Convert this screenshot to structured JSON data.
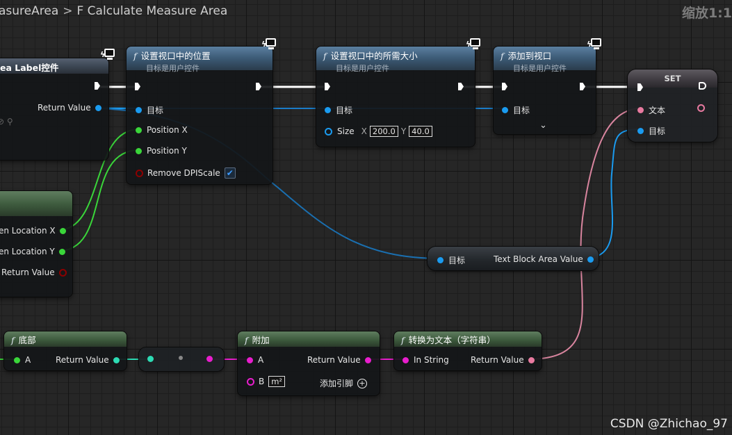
{
  "breadcrumb": {
    "parent": "asureArea",
    "current": "F Calculate Measure Area"
  },
  "zoom": "缩放1:1",
  "watermark": "CSDN @Zhichao_97",
  "nodes": {
    "create_widget": {
      "title": "ea Label控件",
      "return_label": "Return Value"
    },
    "set_position": {
      "title": "设置视口中的位置",
      "subtitle": "目标是用户控件",
      "target": "目标",
      "pos_x": "Position X",
      "pos_y": "Position Y",
      "remove_dpi": "Remove DPIScale"
    },
    "set_desired_size": {
      "title": "设置视口中的所需大小",
      "subtitle": "目标是用户控件",
      "target": "目标",
      "size": "Size",
      "x_label": "X",
      "x_value": "200.0",
      "y_label": "Y",
      "y_value": "40.0"
    },
    "add_to_viewport": {
      "title": "添加到视口",
      "subtitle": "目标是用户控件",
      "target": "目标"
    },
    "set_node": {
      "title": "SET",
      "text": "文本",
      "target": "目标"
    },
    "screen_location": {
      "x": "en Location X",
      "y": "en Location Y",
      "return": "Return Value"
    },
    "text_block_var": {
      "target": "目标",
      "value": "Text Block Area Value"
    },
    "bottom": {
      "title": "底部",
      "a": "A",
      "return": "Return Value"
    },
    "append": {
      "title": "附加",
      "a": "A",
      "b": "B",
      "b_value": "m²",
      "return": "Return Value",
      "add_pin": "添加引脚"
    },
    "to_text": {
      "title": "转换为文本（字符串）",
      "in": "In String",
      "return": "Return Value"
    }
  },
  "colors": {
    "exec": "#ffffff",
    "object": "#1a9bf0",
    "float": "#3ad63a",
    "text": "#e87aa0",
    "string": "#e81ecd",
    "bool": "#8c0000",
    "vector": "#2ddbb4"
  }
}
